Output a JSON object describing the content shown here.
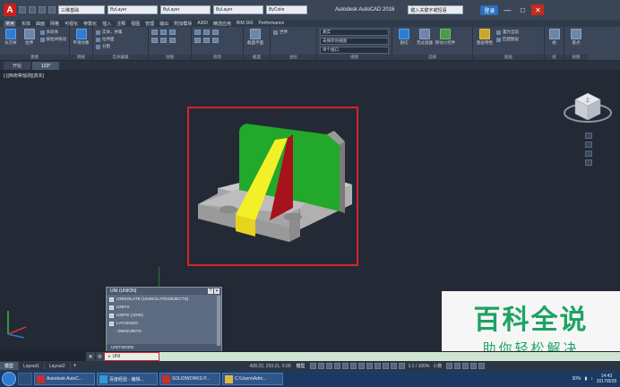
{
  "window": {
    "app_title": "Autodesk AutoCAD 2016",
    "workspace_combo": "三维基础",
    "layer_combo": "ByLayer",
    "linetype_combo": "ByLayer",
    "lineweight_combo": "ByLayer",
    "color_combo": "ByColor",
    "search_placeholder": "键入关键字或短语",
    "login_label": "登录",
    "minimize": "—",
    "maximize": "□",
    "close": "✕"
  },
  "menubar": {
    "items": [
      "常用",
      "实体",
      "曲面",
      "网格",
      "可视化",
      "参数化",
      "插入",
      "注释",
      "视图",
      "管理",
      "输出",
      "附加模块",
      "A360",
      "精选应用",
      "BIM 360",
      "Performance"
    ]
  },
  "ribbon": {
    "panels": [
      {
        "title": "建模",
        "tools": [
          "长方体",
          "拉伸"
        ],
        "rows": [
          "多段体",
          "按住并拖动"
        ]
      },
      {
        "title": "网格",
        "tools": [
          "平滑对象"
        ],
        "rows": []
      },
      {
        "title": "实体编辑",
        "tools": [],
        "rows": [
          "实体，并集",
          "拉伸面",
          "分割"
        ]
      },
      {
        "title": "绘图",
        "tools": [],
        "rows": []
      },
      {
        "title": "修改",
        "tools": [],
        "rows": []
      },
      {
        "title": "截面",
        "tools": [
          "截面平面"
        ],
        "rows": []
      },
      {
        "title": "坐标",
        "tools": [],
        "rows": [
          "世界"
        ]
      },
      {
        "title": "视图",
        "tools": [],
        "rows": [
          "真实",
          "未保存的视图",
          "单个视口"
        ]
      },
      {
        "title": "选择",
        "tools": [
          "剖切",
          "无过滤器",
          "移动小控件"
        ],
        "rows": []
      },
      {
        "title": "图层",
        "tools": [
          "图层特性"
        ],
        "rows": [
          "置为当前",
          "匹配图层"
        ]
      },
      {
        "title": "组",
        "tools": [
          "组"
        ],
        "rows": []
      },
      {
        "title": "视图",
        "tools": [
          "基点"
        ],
        "rows": []
      }
    ]
  },
  "filetabs": {
    "items": [
      {
        "label": "开始",
        "active": false
      },
      {
        "label": "123*",
        "active": true
      }
    ]
  },
  "viewport": {
    "label": "[-][西南等轴测][真实]",
    "viewcube_face": "上"
  },
  "autocomplete": {
    "header": "UNI (UNION)",
    "items": [
      {
        "label": "UNISOLATE (UNISOLATEOBJECTS)",
        "sub": false
      },
      {
        "label": "UNITS",
        "sub": false
      },
      {
        "label": "UNITE (JOIN)",
        "sub": false
      },
      {
        "label": "LAYUNISO",
        "sub": false
      },
      {
        "label": "-DWGUNITS",
        "sub": true
      }
    ],
    "footer": "UNITMODE"
  },
  "cmdline": {
    "close": "✕",
    "gear": "⚙",
    "value": "UNI"
  },
  "layout_tabs": {
    "items": [
      {
        "label": "模型",
        "active": true
      },
      {
        "label": "Layout1",
        "active": false
      },
      {
        "label": "Layout2",
        "active": false
      }
    ],
    "add": "+"
  },
  "status": {
    "coords": "428.22, 233.21, 0.00",
    "mode": "模型",
    "scale": "1:1 / 100%",
    "units": "小数"
  },
  "taskbar": {
    "tasks": [
      {
        "label": "Autodesk AutoC..."
      },
      {
        "label": "百度经验 - 编辑..."
      },
      {
        "label": "SOLIDWORKS P..."
      },
      {
        "label": "C:\\Users\\Adm..."
      }
    ],
    "battery": "30%",
    "clock_time": "14:43",
    "clock_date": "2017/8/28"
  },
  "watermark": {
    "main": "百科全说",
    "sub": "助你轻松解决"
  },
  "colors": {
    "accent": "#2d6fbf",
    "highlight": "#d8232a",
    "green_face": "#22a82b",
    "yellow_face": "#f4f028",
    "red_face": "#a8121a",
    "base_gray": "#b3b3b3",
    "watermark": "#1da362"
  }
}
